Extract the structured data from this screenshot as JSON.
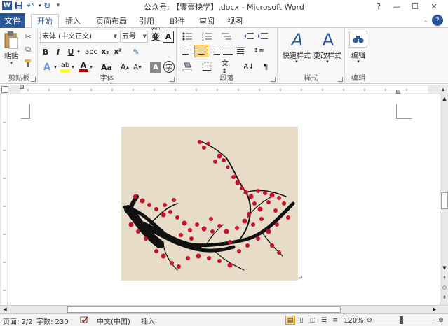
{
  "window": {
    "title": "公众号: 【零壹快学】.docx - Microsoft Word",
    "controls": {
      "help": "?",
      "minimize": "—",
      "restore": "☐",
      "close": "✕"
    }
  },
  "quick_access": [
    "save-icon",
    "undo-icon",
    "redo-icon",
    "customize-icon"
  ],
  "tabs": [
    {
      "label": "文件",
      "active": false,
      "type": "file"
    },
    {
      "label": "开始",
      "active": true
    },
    {
      "label": "插入",
      "active": false
    },
    {
      "label": "页面布局",
      "active": false
    },
    {
      "label": "引用",
      "active": false
    },
    {
      "label": "邮件",
      "active": false
    },
    {
      "label": "审阅",
      "active": false
    },
    {
      "label": "视图",
      "active": false
    }
  ],
  "ribbon": {
    "clipboard": {
      "label": "剪贴板",
      "paste_label": "粘贴"
    },
    "font": {
      "label": "字体",
      "font_name": "宋体 (中文正文)",
      "font_size": "五号",
      "wen": "wén",
      "bold": "B",
      "italic": "I",
      "underline": "U",
      "strike": "abc",
      "sub": "x₂",
      "sup": "x²",
      "grow": "A",
      "shrink": "A",
      "aa": "Aa",
      "font_color_letter": "A",
      "highlight_letter": "ab",
      "font_color": "#c00000",
      "highlight_color": "#ffff00"
    },
    "paragraph": {
      "label": "段落"
    },
    "styles": {
      "label": "样式",
      "quick_styles": "快速样式",
      "change_styles": "更改样式"
    },
    "editing": {
      "label": "编辑",
      "editing_label": "编辑"
    }
  },
  "document": {
    "image_alt": "plum-blossom-branch",
    "background_color": "#e7dcc7",
    "blossom_color": "#c8102e"
  },
  "status": {
    "page": "页面: 2/2",
    "words": "字数: 230",
    "language": "中文(中国)",
    "mode": "插入",
    "zoom": "120%"
  }
}
